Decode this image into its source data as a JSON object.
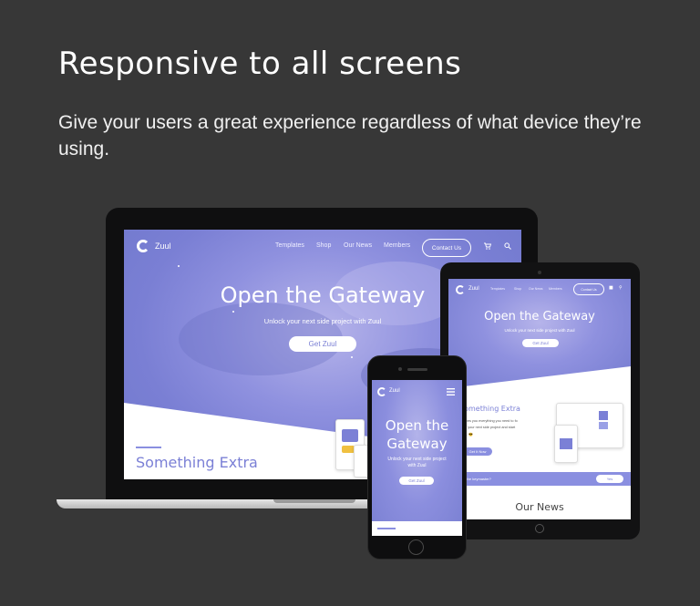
{
  "page": {
    "heading": "Responsive to all screens",
    "subheading": "Give your users a great experience regardless of what device they’re using."
  },
  "colors": {
    "background": "#373737",
    "hero_purple": "#8f91df",
    "accent": "#7b80d6"
  },
  "laptop": {
    "logo": "Zuul",
    "nav": [
      "Templates",
      "Shop",
      "Our News",
      "Members"
    ],
    "contact_label": "Contact Us",
    "icons": [
      "cart-icon",
      "search-icon"
    ],
    "hero_title": "Open the Gateway",
    "hero_subtitle": "Unlock your next side project with Zuul",
    "cta_label": "Get Zuul",
    "section_title": "Something Extra"
  },
  "tablet": {
    "logo": "Zuul",
    "nav": [
      "Templates",
      "Shop",
      "Our News",
      "Members"
    ],
    "contact_label": "Contact Us",
    "hero_title": "Open the Gateway",
    "hero_subtitle": "Unlock your next side project with Zuul",
    "cta_label": "Get Zuul",
    "section_title": "Something Extra",
    "section_text_1": "gives you everything you need to fo",
    "section_text_2": "off your next side project and start",
    "section_text_3": "ng. 😎",
    "section_button": "Get It Now",
    "banner_text": "you the keymaster?",
    "banner_button": "Yes",
    "news_title": "Our News"
  },
  "phone": {
    "logo": "Zuul",
    "hero_title_line1": "Open the",
    "hero_title_line2": "Gateway",
    "hero_subtitle_line1": "Unlock your next side project",
    "hero_subtitle_line2": "with Zuul",
    "cta_label": "Get Zuul"
  }
}
